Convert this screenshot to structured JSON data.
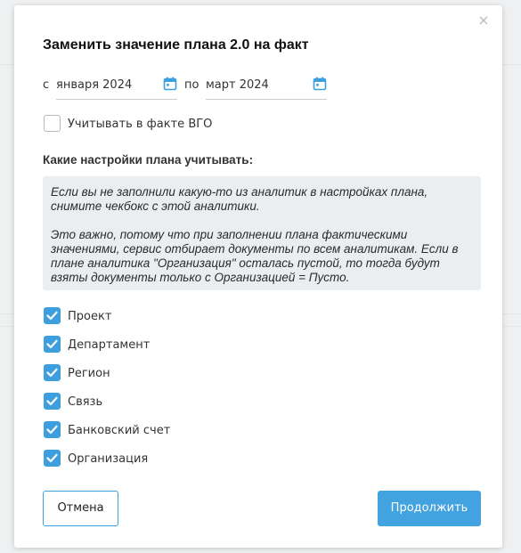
{
  "dialog": {
    "title": "Заменить значение плана 2.0 на факт",
    "close_glyph": "×"
  },
  "period": {
    "from_prefix": "с",
    "from_value": "января 2024",
    "separator": "по",
    "to_value": "март 2024",
    "icon": "calendar-icon"
  },
  "vgo": {
    "label": "Учитывать в факте ВГО",
    "checked": false
  },
  "settings": {
    "title": "Какие настройки плана учитывать:",
    "note_p1": "Если вы не заполнили какую-то из аналитик в настройках плана, снимите чекбокс с этой аналитики.",
    "note_p2": "Это важно, потому что при заполнении плана фактическими значениями, сервис отбирает документы по всем аналитикам. Если в плане аналитика \"Организация\" осталась пустой, то тогда будут взяты документы только с Организацией = Пусто.",
    "analytics": [
      {
        "label": "Проект",
        "checked": true
      },
      {
        "label": "Департамент",
        "checked": true
      },
      {
        "label": "Регион",
        "checked": true
      },
      {
        "label": "Связь",
        "checked": true
      },
      {
        "label": "Банковский счет",
        "checked": true
      },
      {
        "label": "Организация",
        "checked": true
      }
    ]
  },
  "actions": {
    "cancel_label": "Отмена",
    "continue_label": "Продолжить"
  },
  "colors": {
    "accent": "#3d9fde",
    "note_bg": "#ebeef1"
  }
}
